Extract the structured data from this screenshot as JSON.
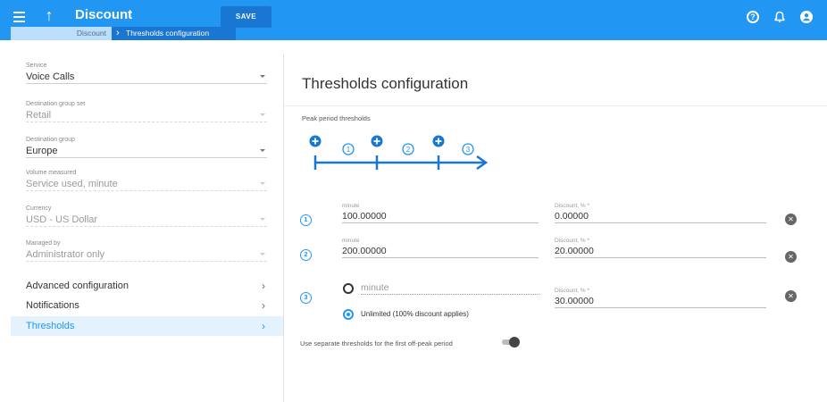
{
  "header": {
    "title": "Discount",
    "save_label": "SAVE",
    "breadcrumb_parent": "Discount",
    "breadcrumb_current": "Thresholds configuration",
    "accent": "#2196f3"
  },
  "sidebar": {
    "fields": [
      {
        "label": "Service",
        "value": "Voice Calls",
        "disabled": false
      },
      {
        "label": "Destination group set",
        "value": "Retail",
        "disabled": true
      },
      {
        "label": "Destination group",
        "value": "Europe",
        "disabled": false
      },
      {
        "label": "Volume measured",
        "value": "Service used, minute",
        "disabled": true
      },
      {
        "label": "Currency",
        "value": "USD - US Dollar",
        "disabled": true
      },
      {
        "label": "Managed by",
        "value": "Administrator only",
        "disabled": true
      }
    ],
    "nav": [
      {
        "label": "Advanced configuration",
        "active": false
      },
      {
        "label": "Notifications",
        "active": false
      },
      {
        "label": "Thresholds",
        "active": true
      }
    ]
  },
  "main": {
    "title": "Thresholds configuration",
    "section_label": "Peak period thresholds",
    "timeline_labels": [
      "1",
      "2",
      "3"
    ],
    "rows": [
      {
        "num": "1",
        "volume_label": "minute",
        "volume_value": "100.00000",
        "discount_label": "Discount, % *",
        "discount_value": "0.00000"
      },
      {
        "num": "2",
        "volume_label": "minute",
        "volume_value": "200.00000",
        "discount_label": "Discount, % *",
        "discount_value": "20.00000"
      },
      {
        "num": "3",
        "volume_placeholder": "minute",
        "unlimited_label": "Unlimited (100% discount applies)",
        "discount_label": "Discount, % *",
        "discount_value": "30.00000"
      }
    ],
    "toggle_label": "Use separate thresholds for the first off-peak period",
    "toggle_on": false
  }
}
